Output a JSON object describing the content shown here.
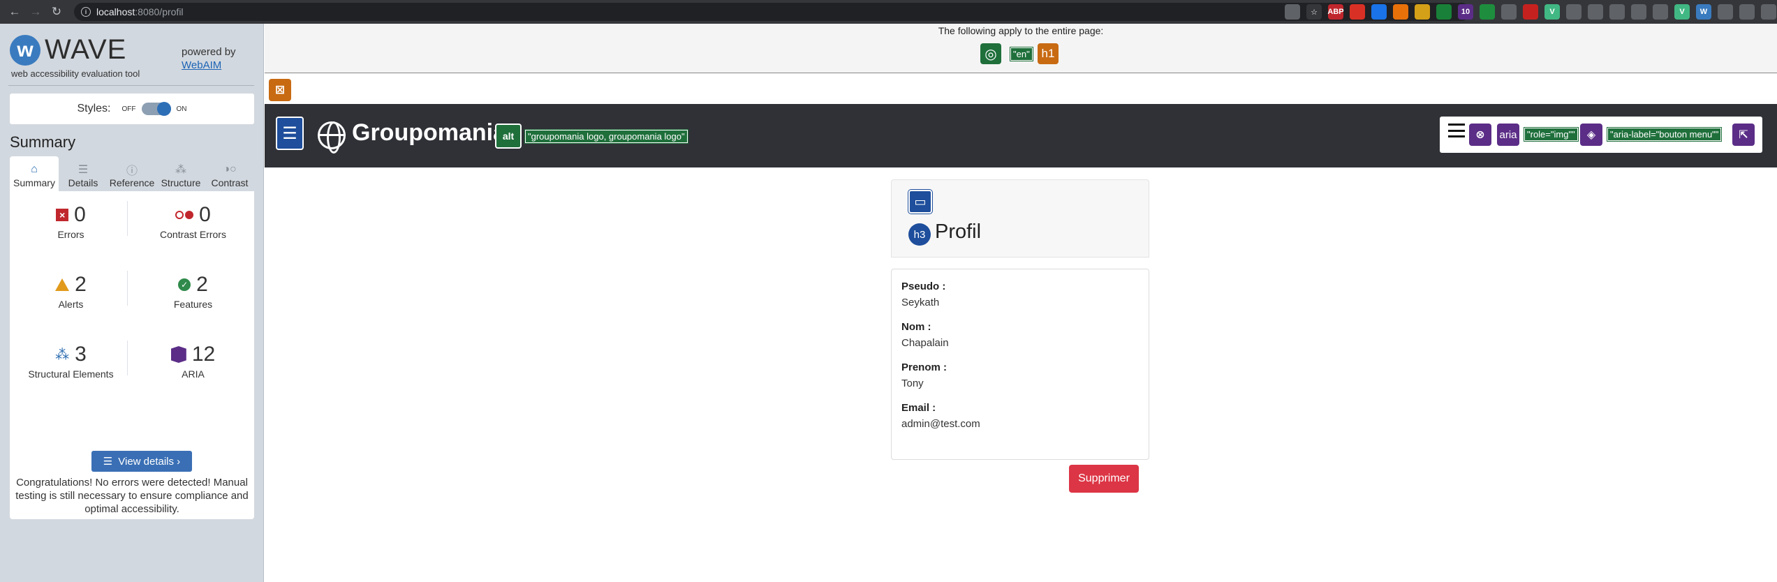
{
  "browser": {
    "url_host": "localhost",
    "url_path": ":8080/profil",
    "extensions": [
      {
        "name": "translate-icon",
        "label": "",
        "color": "#5f6368"
      },
      {
        "name": "star-icon",
        "label": "☆",
        "color": "#35363a"
      },
      {
        "name": "abp-icon",
        "label": "ABP",
        "color": "#c0272d"
      },
      {
        "name": "ext-red-icon",
        "label": "",
        "color": "#d93025"
      },
      {
        "name": "chrome-icon",
        "label": "",
        "color": "#1a73e8"
      },
      {
        "name": "ext-orange-icon",
        "label": "",
        "color": "#e8710a"
      },
      {
        "name": "flag-icon",
        "label": "",
        "color": "#d4a017"
      },
      {
        "name": "ext-green-icon",
        "label": "",
        "color": "#188038"
      },
      {
        "name": "badge-icon",
        "label": "10",
        "color": "#5b2d87"
      },
      {
        "name": "pen-icon",
        "label": "",
        "color": "#1e8e3e"
      },
      {
        "name": "gear-icon",
        "label": "",
        "color": "#5f6368"
      },
      {
        "name": "ext-doc-icon",
        "label": "",
        "color": "#c5221f"
      },
      {
        "name": "vue-icon",
        "label": "V",
        "color": "#41b883"
      },
      {
        "name": "ext-circle-icon",
        "label": "",
        "color": "#5f6368"
      },
      {
        "name": "ext-grid-icon",
        "label": "",
        "color": "#5f6368"
      },
      {
        "name": "camera-icon",
        "label": "",
        "color": "#5f6368"
      },
      {
        "name": "ext-ring-icon",
        "label": "",
        "color": "#5f6368"
      },
      {
        "name": "ext-cast-icon",
        "label": "",
        "color": "#5f6368"
      },
      {
        "name": "vue-icon-2",
        "label": "V",
        "color": "#41b883"
      },
      {
        "name": "wave-ext-icon",
        "label": "W",
        "color": "#3a7bbf"
      },
      {
        "name": "ext-dots-icon",
        "label": "",
        "color": "#5f6368"
      },
      {
        "name": "puzzle-icon",
        "label": "",
        "color": "#5f6368"
      },
      {
        "name": "queue-icon",
        "label": "",
        "color": "#5f6368"
      }
    ]
  },
  "wave": {
    "logo_text": "WAVE",
    "tagline": "web accessibility evaluation tool",
    "powered_by": "powered by",
    "webaim": "WebAIM",
    "styles_label": "Styles:",
    "styles_off": "OFF",
    "styles_on": "ON",
    "summary_heading": "Summary",
    "tabs": [
      "Summary",
      "Details",
      "Reference",
      "Structure",
      "Contrast"
    ],
    "stats": {
      "errors": {
        "value": "0",
        "label": "Errors"
      },
      "contrast": {
        "value": "0",
        "label": "Contrast Errors"
      },
      "alerts": {
        "value": "2",
        "label": "Alerts"
      },
      "features": {
        "value": "2",
        "label": "Features"
      },
      "structural": {
        "value": "3",
        "label": "Structural Elements"
      },
      "aria": {
        "value": "12",
        "label": "ARIA"
      }
    },
    "view_details": "View details ›",
    "congrats": "Congratulations! No errors were detected! Manual testing is still necessary to ensure compliance and optimal accessibility."
  },
  "page": {
    "notice": "The following apply to the entire page:",
    "lang_label": "\"en\"",
    "h1_label": "h1",
    "brand": "Groupomania",
    "logo_alt": "\"groupomania logo, groupomania logo\"",
    "aria_label": "aria",
    "role_label": "\"role=\"img\"\"",
    "aria_menu_label": "\"aria-label=\"bouton menu\"\"",
    "h3_label": "h3",
    "card_title": "Profil",
    "fields": [
      {
        "key": "Pseudo :",
        "value": "Seykath"
      },
      {
        "key": "Nom :",
        "value": "Chapalain"
      },
      {
        "key": "Prenom :",
        "value": "Tony"
      },
      {
        "key": "Email :",
        "value": "admin@test.com"
      }
    ],
    "delete_button": "Supprimer"
  },
  "colors": {
    "header_bg": "#2f3137",
    "delete": "#dc3545",
    "wave_blue": "#3a6fb5",
    "feature_green": "#1f6f3b",
    "aria_purple": "#5b2d87"
  }
}
